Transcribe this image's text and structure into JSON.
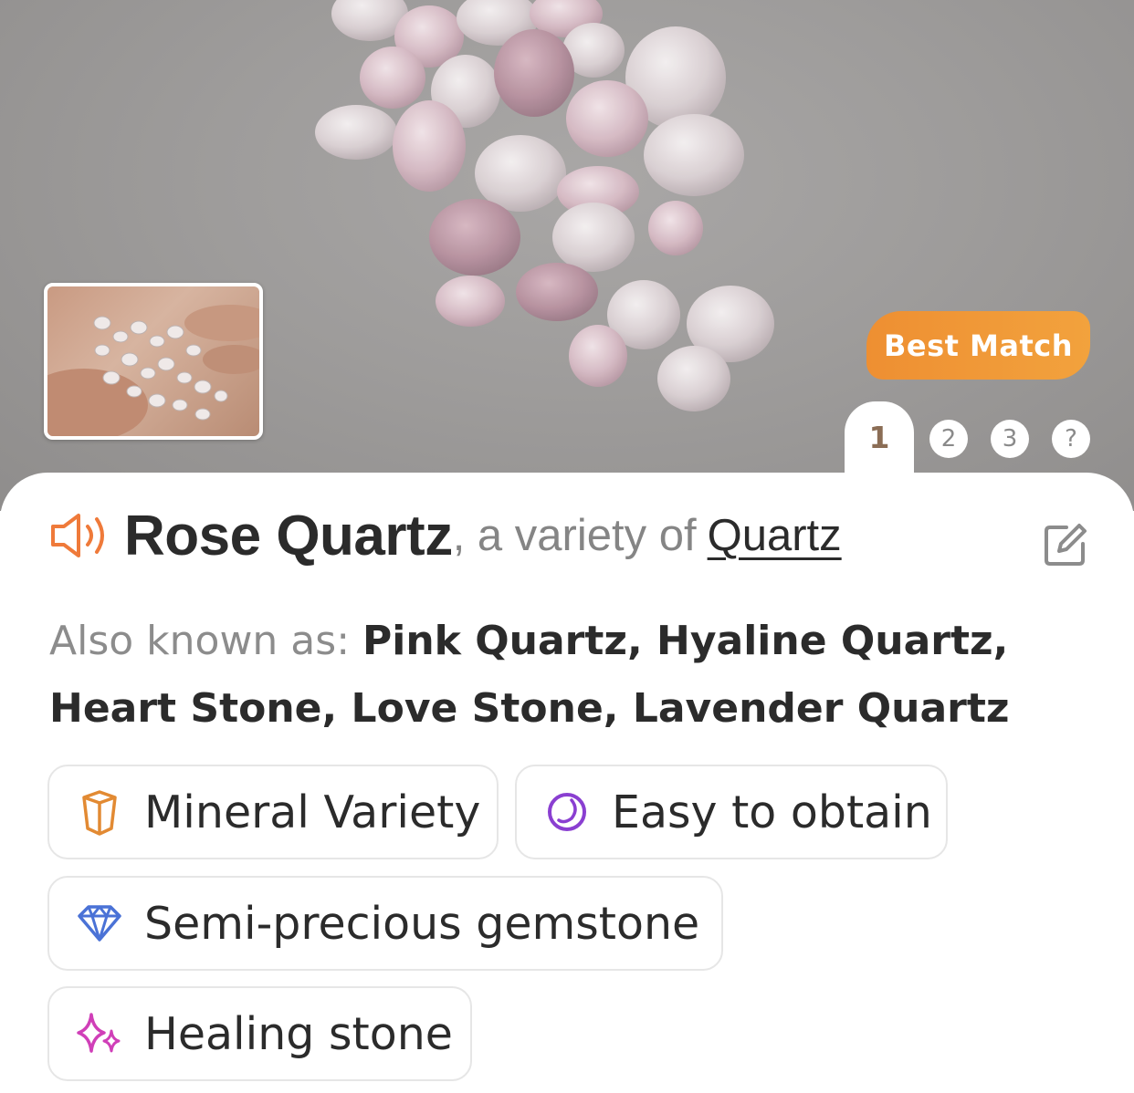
{
  "hero": {
    "best_match_label": "Best Match",
    "pager": {
      "active": "1",
      "others": [
        "2",
        "3",
        "?"
      ]
    }
  },
  "title": {
    "name": "Rose Quartz",
    "variety_text": ", a variety of",
    "parent": "Quartz"
  },
  "also_known": {
    "label": "Also known as: ",
    "names": "Pink Quartz, Hyaline Quartz, Heart Stone, Love Stone, Lavender Quartz"
  },
  "tags": [
    {
      "label": "Mineral Variety",
      "icon": "crystal-icon",
      "color": "#e28a33"
    },
    {
      "label": "Easy to obtain",
      "icon": "stone-icon",
      "color": "#8a3fd1"
    },
    {
      "label": "Semi-precious gemstone",
      "icon": "diamond-icon",
      "color": "#4a72d6"
    },
    {
      "label": "Healing stone",
      "icon": "sparkle-icon",
      "color": "#d03fb8"
    }
  ],
  "colors": {
    "accent_orange": "#ee8f32",
    "speaker_orange": "#ef7a3a",
    "text_dark": "#2b2b2b",
    "text_muted": "#8c8c8c"
  }
}
